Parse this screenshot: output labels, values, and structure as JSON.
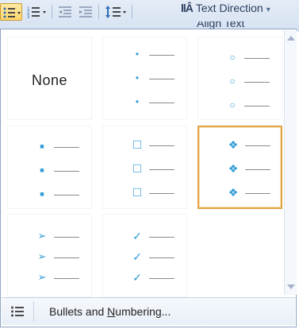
{
  "ribbon": {
    "text_direction_label": "Text Direction",
    "text_direction_glyph": "llÂ",
    "partial_label": "Align Text"
  },
  "gallery": {
    "none_label": "None",
    "selected_index": 5,
    "items": [
      {
        "name": "none",
        "label": "None"
      },
      {
        "name": "small-dot-bullets",
        "glyph": "•",
        "color": "#2e9bd6"
      },
      {
        "name": "hollow-circle-bullets",
        "glyph": "○",
        "color": "#2e9bd6"
      },
      {
        "name": "square-bullets",
        "glyph": "■",
        "color": "#2e9bd6"
      },
      {
        "name": "hollow-square-bullets",
        "glyph": "□",
        "color": "#2e9bd6"
      },
      {
        "name": "four-diamond-bullets",
        "glyph": "❖",
        "color": "#2e9bd6"
      },
      {
        "name": "arrow-bullets",
        "glyph": "➢",
        "color": "#2e9bd6"
      },
      {
        "name": "checkmark-bullets",
        "glyph": "✓",
        "color": "#2e9bd6"
      }
    ]
  },
  "footer": {
    "label_before": "Bullets and ",
    "label_underlined": "N",
    "label_after": "umbering..."
  },
  "colors": {
    "accent": "#2e9bd6",
    "selection_border": "#e0a44a",
    "ribbon_bg": "#dbe6f4"
  }
}
